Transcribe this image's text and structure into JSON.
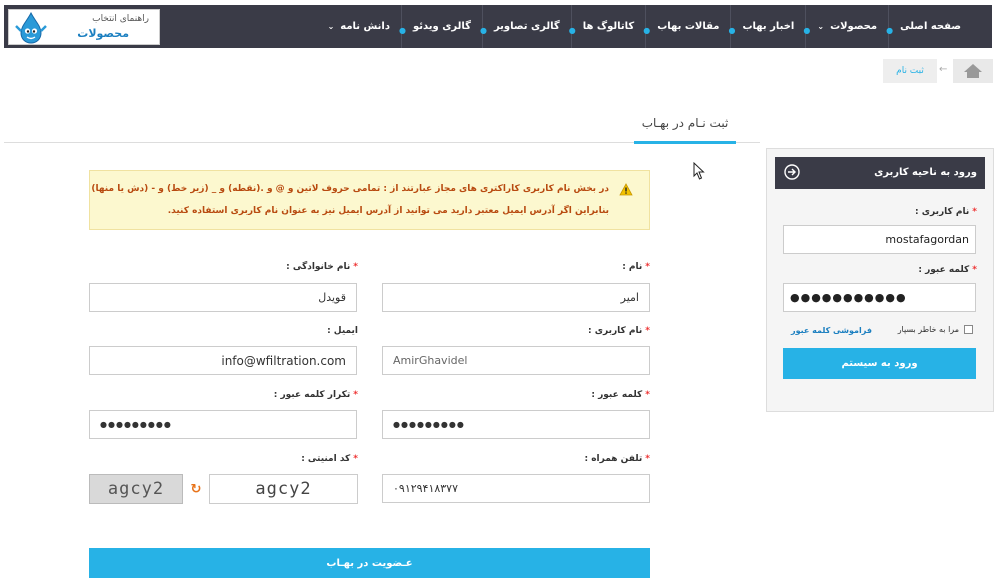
{
  "logo": {
    "line1": "راهنمای انتخاب",
    "line2": "محصولات"
  },
  "nav": {
    "items": [
      {
        "label": "صفحه اصلی",
        "caret": ""
      },
      {
        "label": "محصولات",
        "caret": "⌄"
      },
      {
        "label": "اخبار بهاب",
        "caret": ""
      },
      {
        "label": "مقالات بهاب",
        "caret": ""
      },
      {
        "label": "کاتالوگ ها",
        "caret": ""
      },
      {
        "label": "گالری تصاویر",
        "caret": ""
      },
      {
        "label": "گالری ویدئو",
        "caret": ""
      },
      {
        "label": "دانش نامه",
        "caret": "⌄"
      }
    ]
  },
  "breadcrumb": {
    "arrow": "←",
    "current": "ثبت نام"
  },
  "tabs": {
    "active": "ثبت نـام در بهـاب"
  },
  "alert": {
    "line1": "در بخش نام کاربری کاراکتری های مجاز عبارتند از : تمامی حروف لاتین و @ و .(نقطه) و _ (زیر خط) و - (دش یا منها)",
    "line2": "بنابراین اگر آدرس ایمیل معتبر دارید می توانید از آدرس ایمیل نیز به عنوان نام کاربری استفاده کنید."
  },
  "form": {
    "required_mark": "*",
    "first_name_label": "نام :",
    "first_name_value": "امیر",
    "last_name_label": "نام خانوادگی :",
    "last_name_value": "قویدل",
    "username_label": "نام کاربری :",
    "username_value": "AmirGhavidel",
    "email_label": "ایمیل :",
    "email_value": "info@wfiltration.com",
    "password_label": "کلمه عبور :",
    "password_value": "●●●●●●●●●",
    "password_repeat_label": "تکرار کلمه عبور :",
    "password_repeat_value": "●●●●●●●●●",
    "mobile_label": "تلفن همراه :",
    "mobile_value": "۰۹۱۲۹۴۱۸۳۷۷",
    "captcha_label": "کد امنیتی :",
    "captcha_image_text": "agcy2",
    "captcha_value": "agcy2",
    "submit_label": "عـضویت در بهـاب"
  },
  "login": {
    "title": "ورود به ناحیه کاربری",
    "username_label": "نام کاربری :",
    "username_value": "mostafagordan",
    "password_label": "کلمه عبور :",
    "password_value": "●●●●●●●●●●●",
    "remember_label": "مرا به خاطر بسپار",
    "forgot_label": "فراموشی کلمه عبور",
    "submit_label": "ورود به سیستم"
  },
  "colors": {
    "navbar": "#3a3b47",
    "accent": "#27b2e6",
    "alert_bg": "#fcf8cf",
    "alert_text": "#b84a10"
  },
  "icons": [
    "water-drop-mascot-icon",
    "home-icon",
    "warning-icon",
    "refresh-icon",
    "login-arrow-icon",
    "mouse-cursor-icon"
  ]
}
